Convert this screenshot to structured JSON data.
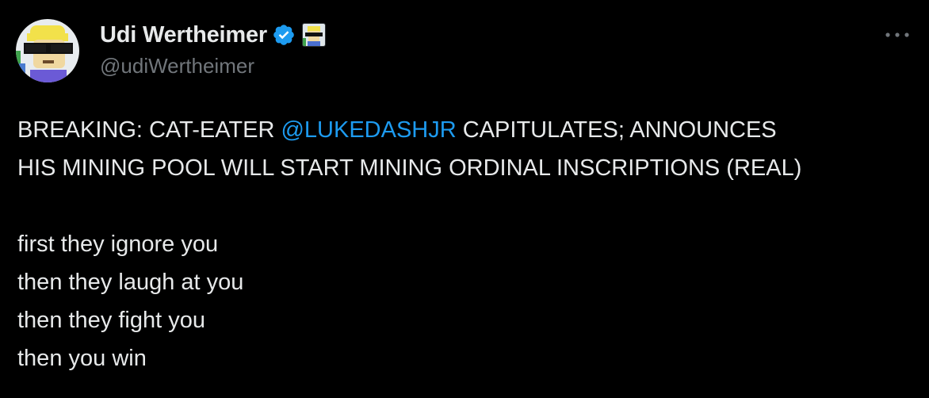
{
  "author": {
    "display_name": "Udi Wertheimer",
    "handle": "@udiWertheimer",
    "avatar_icon": "pixel-glasses-avatar-icon",
    "verified_icon": "verified-badge-icon",
    "affiliation_icon": "affiliation-badge-icon"
  },
  "menu": {
    "more_icon": "more-options-icon"
  },
  "tweet": {
    "line1_before": "BREAKING: CAT-EATER ",
    "mention": "@LUKEDASHJR",
    "line1_after": " CAPITULATES; ANNOUNCES",
    "line2": "HIS MINING POOL WILL START MINING ORDINAL INSCRIPTIONS (REAL)",
    "lines": [
      "first they ignore you",
      "then they laugh at you",
      "then they fight you",
      "then you win"
    ]
  },
  "colors": {
    "background": "#000000",
    "text": "#e7e9ea",
    "secondary": "#71767b",
    "accent": "#1d9bf0"
  }
}
